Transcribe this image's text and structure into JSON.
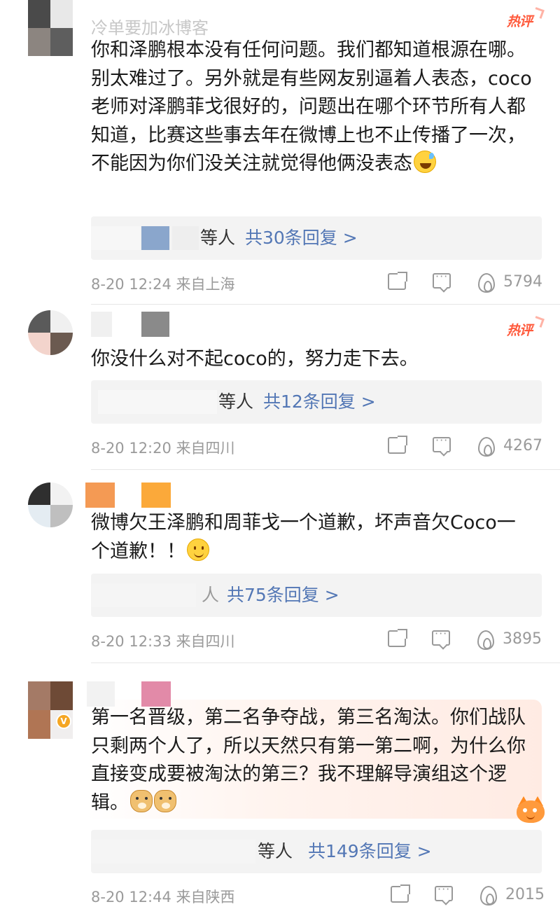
{
  "comments": [
    {
      "username_partial": "冷单要加冰博客",
      "hot_label": "热评",
      "text": "你和泽鹏根本没有任何问题。我们都知道根源在哪。别太难过了。另外就是有些网友别逼着人表态，coco 老师对泽鹏菲戈很好的，问题出在哪个环节所有人都知道，比赛这些事去年在微博上也不止传播了一次，不能因为你们没关注就觉得他俩没表态",
      "emoji": "sweat-smile-icon",
      "reply_who": "等人",
      "reply_count": "共30条回复 >",
      "time_location": "8-20 12:24 来自上海",
      "likes": "5794"
    },
    {
      "username_partial": "",
      "hot_label": "热评",
      "text": "你没什么对不起coco的，努力走下去。",
      "emoji": "",
      "reply_who": "等人",
      "reply_count": "共12条回复 >",
      "time_location": "8-20 12:20 来自四川",
      "likes": "4267"
    },
    {
      "username_partial": "",
      "hot_label": "",
      "text": "微博欠王泽鹏和周菲戈一个道歉，坏声音欠Coco一个道歉！！",
      "emoji": "smile-icon",
      "reply_who": "人",
      "reply_count": "共75条回复 >",
      "time_location": "8-20 12:33 来自四川",
      "likes": "3895"
    },
    {
      "username_partial": "",
      "hot_label": "",
      "text": "第一名晋级，第二名争夺战，第三名淘汰。你们战队只剩两个人了，所以天然只有第一第二啊，为什么你直接变成要被淘汰的第三？我不理解导演组这个逻辑。",
      "emoji": "doge-icon",
      "reply_who": "等人",
      "reply_count": "共149条回复 >",
      "time_location": "8-20 12:44 来自陕西",
      "likes": "2015"
    }
  ],
  "icons": {
    "share": "share-icon",
    "comment": "comment-icon",
    "like": "fire-like-icon",
    "verified": "verified-badge-icon",
    "sticker": "cat-sticker-icon"
  },
  "colors": {
    "hot": "#ff5a3c",
    "reply_link": "#5377b5",
    "meta": "#9a9a9a"
  }
}
